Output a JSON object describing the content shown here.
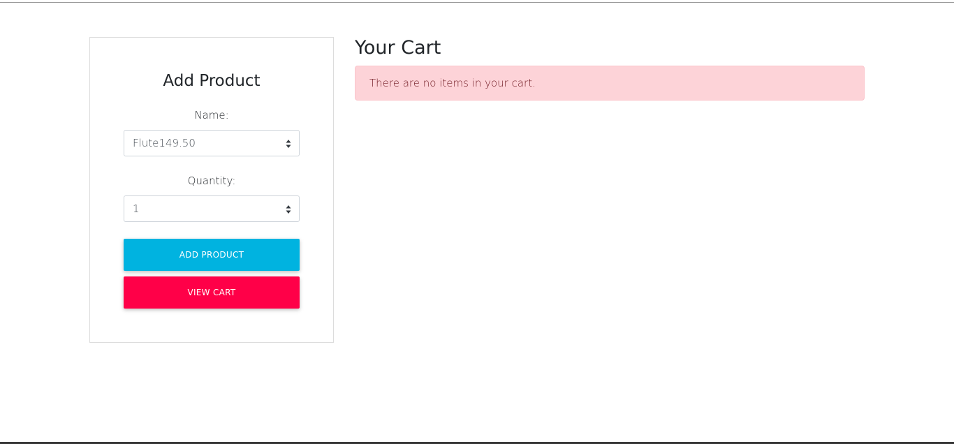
{
  "add_product": {
    "title": "Add Product",
    "name_label": "Name:",
    "name_value": "Flute149.50",
    "quantity_label": "Quantity:",
    "quantity_value": "1",
    "add_button": "ADD PRODUCT",
    "view_cart_button": "VIEW CART"
  },
  "cart": {
    "title": "Your Cart",
    "empty_message": "There are no items in your cart."
  },
  "colors": {
    "add_button": "#00b3e0",
    "view_cart_button": "#ff0048",
    "alert_bg": "#fdd3d8",
    "alert_text": "#721c24"
  },
  "icons": {
    "select_arrows": "sort-arrows-icon"
  }
}
